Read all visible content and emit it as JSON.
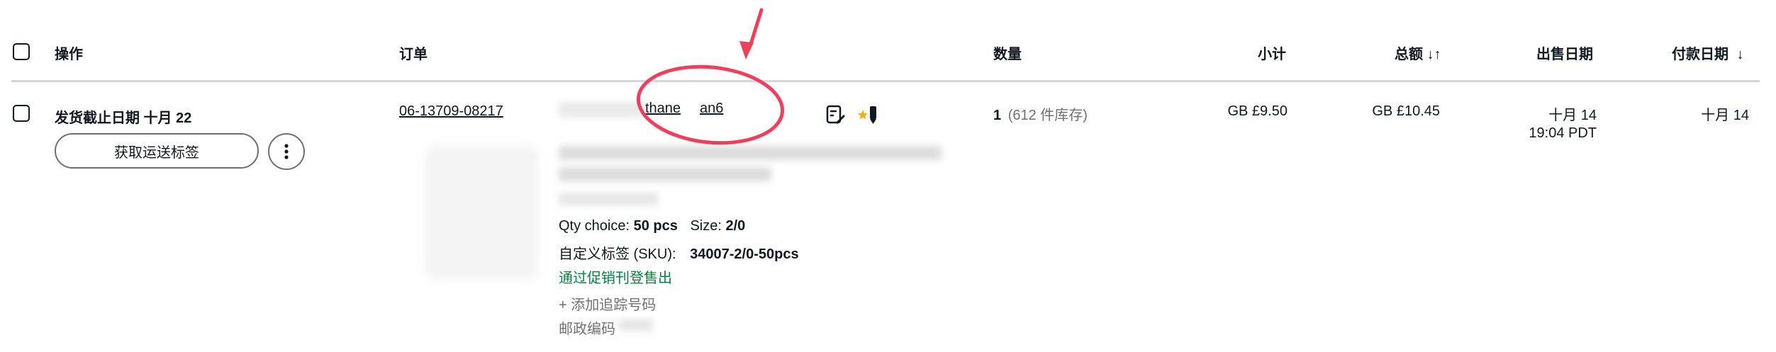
{
  "header": {
    "action": "操作",
    "order": "订单",
    "quantity": "数量",
    "subtotal": "小计",
    "total": "总额",
    "sold_date": "出售日期",
    "paid_date": "付款日期"
  },
  "order_row": {
    "ship_by": "发货截止日期 十月 22",
    "get_label_button": "获取运送标签",
    "order_number": "06-13709-08217",
    "buyer_part1": "thane",
    "buyer_part2": "an6",
    "quantity": "1",
    "stock": "(612 件库存)",
    "subtotal": "GB £9.50",
    "total": "GB £10.45",
    "sold_date": "十月 14",
    "sold_time": "19:04 PDT",
    "paid_date": "十月 14",
    "qty_choice_label": "Qty choice:",
    "qty_choice_value": "50 pcs",
    "size_label": "Size:",
    "size_value": "2/0",
    "sku_label": "自定义标签 (SKU):",
    "sku_value": "34007-2/0-50pcs",
    "promo_text": "通过促销刊登售出",
    "add_tracking": "+ 添加追踪号码",
    "postal_code_label": "邮政编码"
  },
  "icons": {
    "sort_total": "sort-up-down-icon",
    "sort_paid": "arrow-down-icon",
    "more": "more-vertical-icon",
    "note": "note-edit-icon",
    "feedback": "star-feedback-icon"
  },
  "colors": {
    "annotation": "#ee3f5c",
    "promo_green": "#05823f",
    "divider": "#d8d8d8"
  }
}
